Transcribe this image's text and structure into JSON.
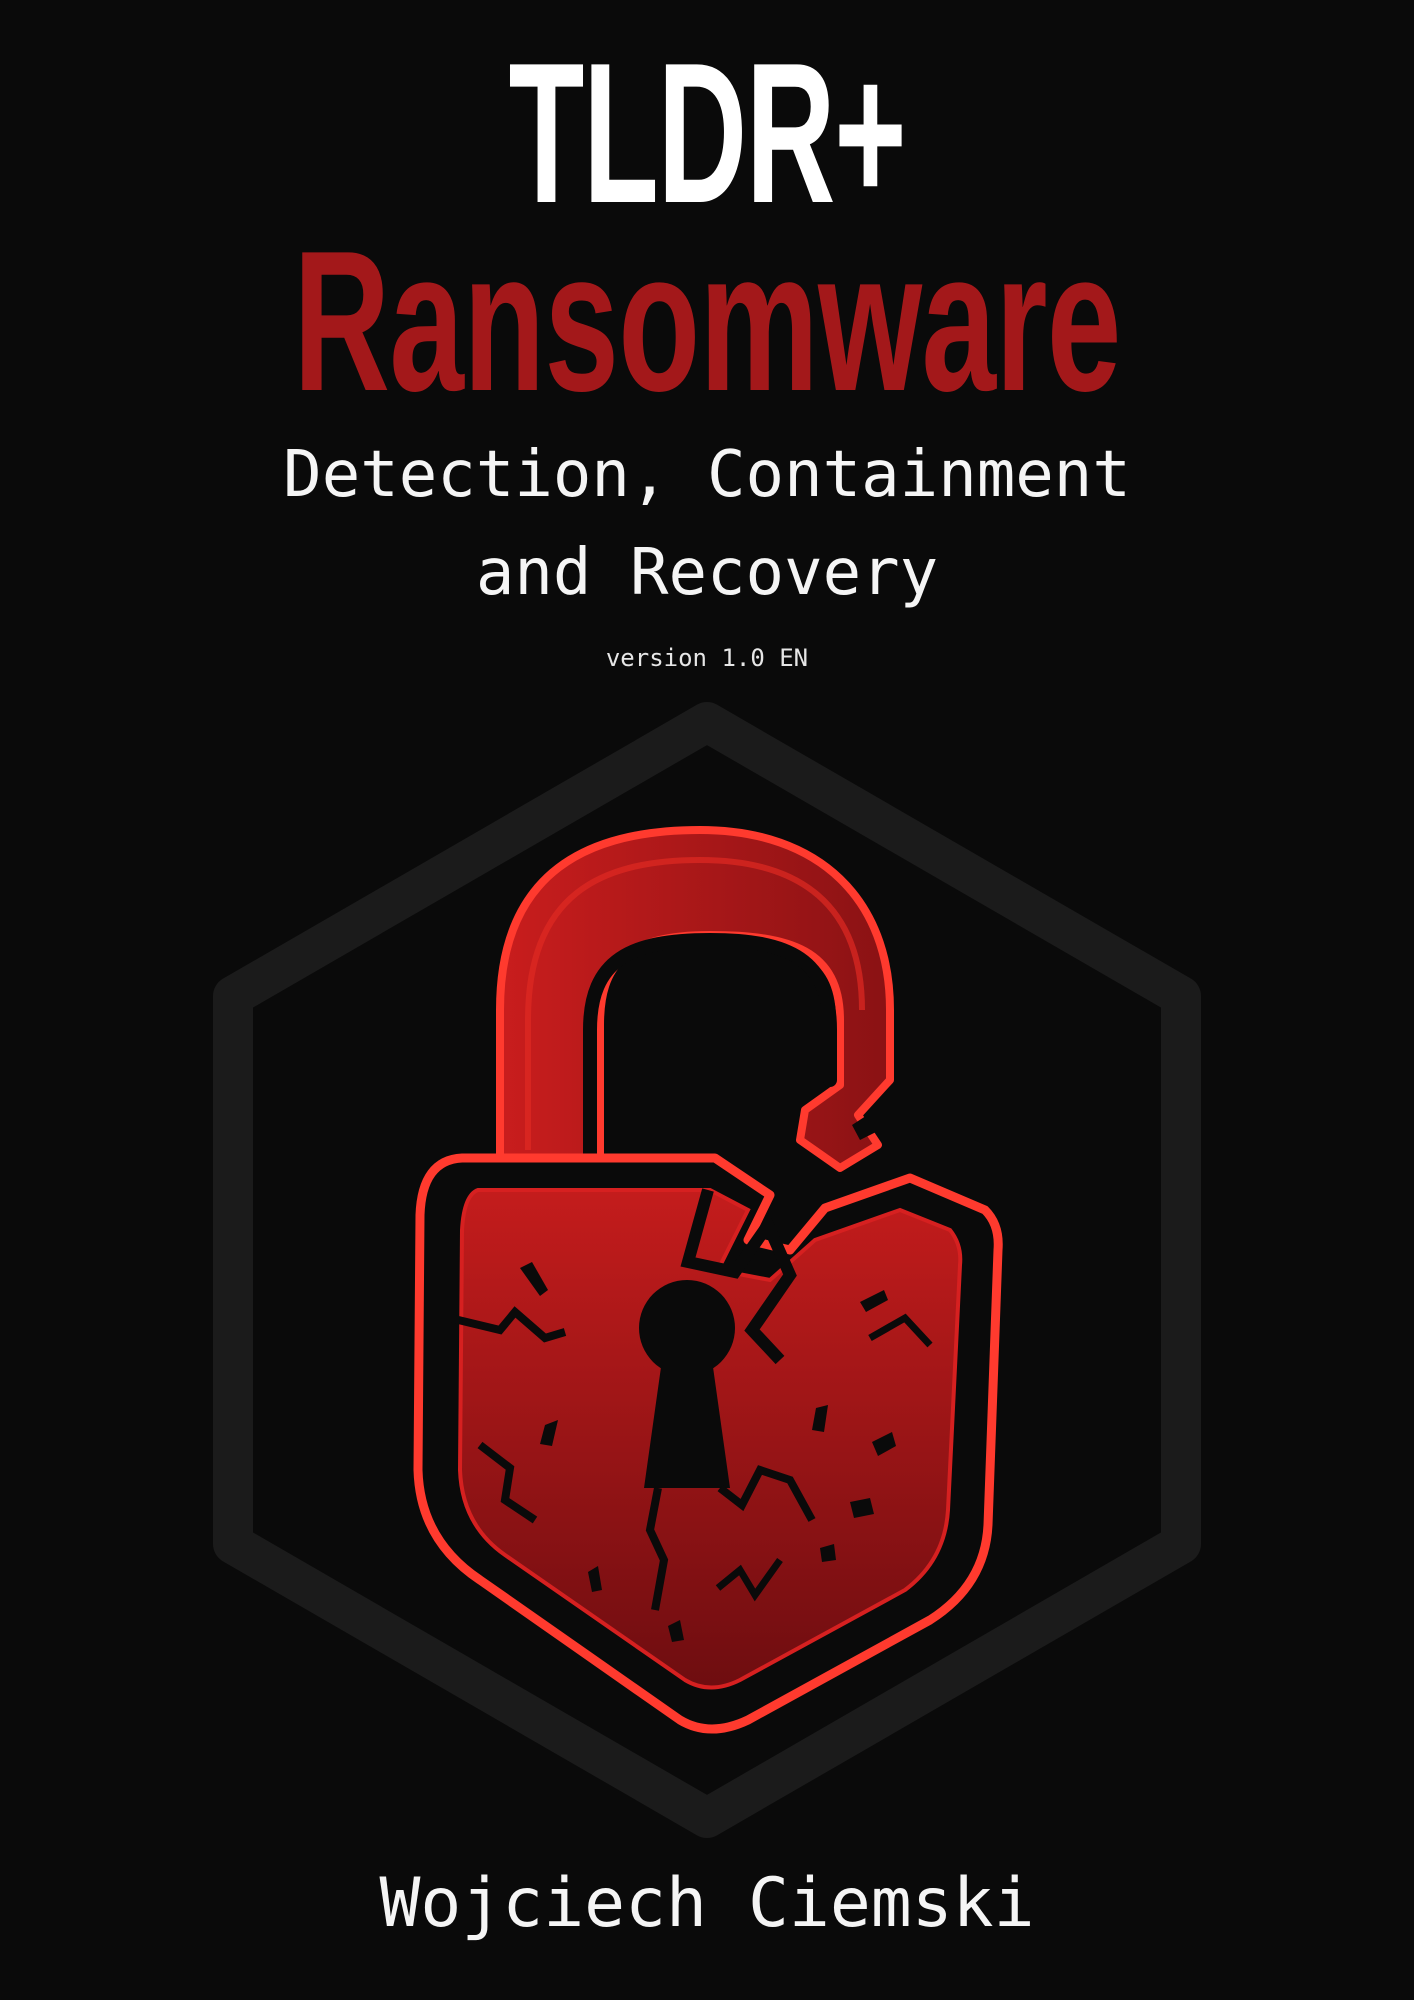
{
  "cover": {
    "brand": "TLDR+",
    "topic": "Ransomware",
    "subtitle_line1": "Detection, Containment",
    "subtitle_line2": "and Recovery",
    "version": "version 1.0 EN",
    "author": "Wojciech Ciemski"
  },
  "emblem": {
    "frame_icon": "hexagon-frame-icon",
    "lock_icon": "broken-open-padlock-icon"
  },
  "colors": {
    "background": "#0a0a0a",
    "accent_red": "#a3181a",
    "frame_gray": "#1b1b1b",
    "text": "#ffffff"
  }
}
